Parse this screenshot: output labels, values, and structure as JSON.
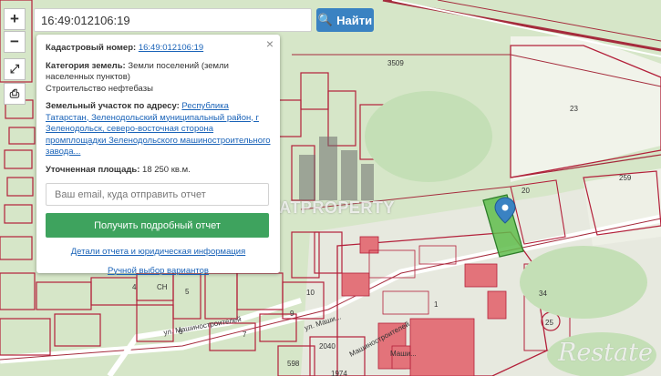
{
  "search": {
    "value": "16:49:012106:19",
    "button_label": "Найти",
    "button_icon": "search-icon"
  },
  "tools": [
    {
      "label": "+",
      "name": "zoom-in-button"
    },
    {
      "label": "−",
      "name": "zoom-out-button"
    },
    {
      "label": "⤢",
      "name": "fullscreen-button"
    },
    {
      "label": "⎙",
      "name": "print-button"
    }
  ],
  "popup": {
    "close_label": "×",
    "cadastral_label": "Кадастровый номер:",
    "cadastral_value": "16:49:012106:19",
    "category_label": "Категория земель:",
    "category_value": "Земли поселений (земли населенных пунктов)",
    "use_value": "Строительство нефтебазы",
    "address_label": "Земельный участок по адресу:",
    "address_value": "Республика Татарстан, Зеленодольский муниципальный район, г Зеленодольск, северо-восточная сторона промплощадки Зеленодольского машиностроительного завода...",
    "area_label": "Уточненная площадь:",
    "area_value": "18 250 кв.м.",
    "email_placeholder": "Ваш email, куда отправить отчет",
    "report_button": "Получить подробный отчет",
    "details_link": "Детали отчета и юридическая информация",
    "manual_link": "Ручной выбор вариантов"
  },
  "watermark": {
    "brand": "TATPROPERTY",
    "restate": "Restate"
  },
  "map_labels": {
    "l3509": "3509",
    "l23": "23",
    "l20": "20",
    "l259": "259",
    "l1": "1",
    "l34": "34",
    "l25": "25",
    "l10": "10",
    "l9": "9",
    "l6": "6",
    "l7": "7",
    "l5": "5",
    "l4": "4",
    "l2040": "2040",
    "l598": "598",
    "l1974": "1974",
    "street1": "ул. Машиностроителей",
    "street2": "ул. Маши...",
    "street3": "Машиностроителей",
    "mash": "Маши...",
    "sn": "СН"
  },
  "colors": {
    "parcel_border": "#b3203a",
    "forest": "#cfe3c4",
    "open_land": "#e8ece0",
    "road": "#ffffff",
    "building": "#e3737a",
    "selected_parcel": "#5fbd4c",
    "accent": "#3a82c2",
    "report_button": "#3ea35e"
  }
}
